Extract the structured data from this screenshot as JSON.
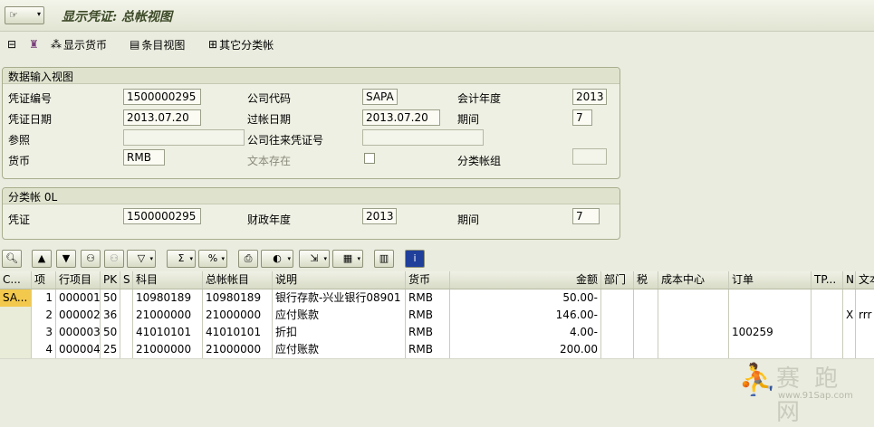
{
  "window": {
    "title": "显示凭证: 总帐视图"
  },
  "toolbar": {
    "items": [
      {
        "icon": "document-overview-icon",
        "label": ""
      },
      {
        "icon": "hat-icon",
        "label": ""
      },
      {
        "icon": "hierarchy-icon",
        "label": "显示货币"
      },
      {
        "icon": "entry-view-icon",
        "label": "条目视图"
      },
      {
        "icon": "ledger-icon",
        "label": "其它分类帐"
      }
    ]
  },
  "data_entry_view": {
    "title": "数据输入视图",
    "doc_no_label": "凭证编号",
    "doc_no": "1500000295",
    "company_code_label": "公司代码",
    "company_code": "SAPA",
    "fiscal_year_label": "会计年度",
    "fiscal_year": "2013",
    "doc_date_label": "凭证日期",
    "doc_date": "2013.07.20",
    "posting_date_label": "过帐日期",
    "posting_date": "2013.07.20",
    "period_label": "期间",
    "period": "7",
    "reference_label": "参照",
    "reference": "",
    "intercompany_label": "公司往来凭证号",
    "intercompany": "",
    "currency_label": "货币",
    "currency": "RMB",
    "text_exists_label": "文本存在",
    "ledger_group_label": "分类帐组",
    "ledger_group": ""
  },
  "ledger_section": {
    "title": "分类帐 0L",
    "doc_label": "凭证",
    "doc_no": "1500000295",
    "fiscal_year_label": "财政年度",
    "fiscal_year": "2013",
    "period_label": "期间",
    "period": "7"
  },
  "table": {
    "columns": [
      "C...",
      "项",
      "行项目",
      "PK",
      "S",
      "科目",
      "总帐帐目",
      "说明",
      "货币",
      "金额",
      "部门",
      "税",
      "成本中心",
      "订单",
      "TP...",
      "N",
      "文本"
    ],
    "rows": [
      {
        "c": "SA...",
        "item": "1",
        "line": "000001",
        "pk": "50",
        "s": "",
        "account": "10980189",
        "gl": "10980189",
        "desc": "银行存款-兴业银行08901",
        "cur": "RMB",
        "amount": "50.00-",
        "dept": "",
        "tax": "",
        "cc": "",
        "order": "",
        "tp": "",
        "n": "",
        "text": ""
      },
      {
        "c": "",
        "item": "2",
        "line": "000002",
        "pk": "36",
        "s": "",
        "account": "21000000",
        "gl": "21000000",
        "desc": "应付账款",
        "cur": "RMB",
        "amount": "146.00-",
        "dept": "",
        "tax": "",
        "cc": "",
        "order": "",
        "tp": "",
        "n": "X",
        "text": "rrr"
      },
      {
        "c": "",
        "item": "3",
        "line": "000003",
        "pk": "50",
        "s": "",
        "account": "41010101",
        "gl": "41010101",
        "desc": "折扣",
        "cur": "RMB",
        "amount": "4.00-",
        "dept": "",
        "tax": "",
        "cc": "",
        "order": "100259",
        "tp": "",
        "n": "",
        "text": ""
      },
      {
        "c": "",
        "item": "4",
        "line": "000004",
        "pk": "25",
        "s": "",
        "account": "21000000",
        "gl": "21000000",
        "desc": "应付账款",
        "cur": "RMB",
        "amount": "200.00",
        "dept": "",
        "tax": "",
        "cc": "",
        "order": "",
        "tp": "",
        "n": "",
        "text": ""
      }
    ]
  },
  "watermark": {
    "name": "赛 跑 网",
    "url": "www.91Sap.com"
  }
}
